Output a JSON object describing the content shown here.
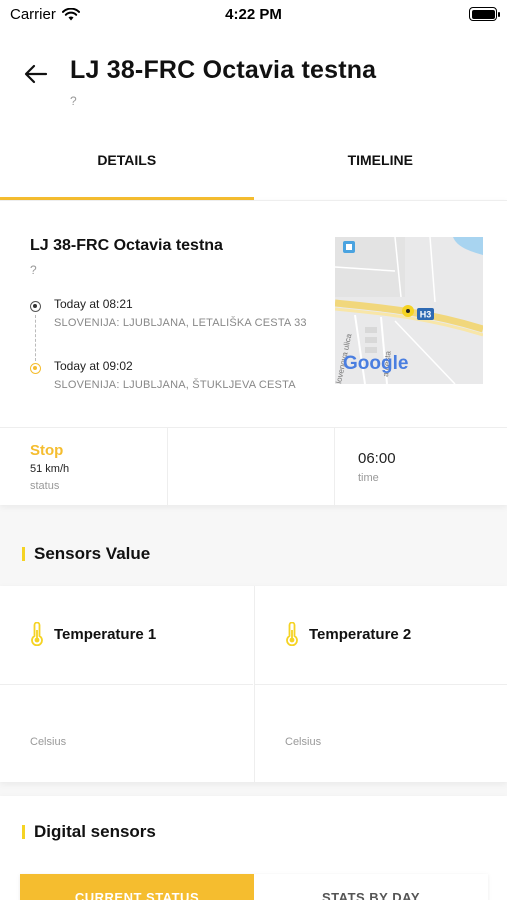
{
  "status_bar": {
    "carrier": "Carrier",
    "time": "4:22 PM"
  },
  "header": {
    "title": "LJ 38-FRC Octavia testna",
    "subtitle": "?"
  },
  "tabs": [
    {
      "label": "DETAILS",
      "active": true
    },
    {
      "label": "TIMELINE",
      "active": false
    }
  ],
  "vehicle": {
    "name": "LJ 38-FRC Octavia testna",
    "subtitle": "?",
    "start": {
      "time": "Today at 08:21",
      "address": "SLOVENIJA: LJUBLJANA, LETALIŠKA CESTA 33"
    },
    "end": {
      "time": "Today at 09:02",
      "address": "SLOVENIJA: LJUBLJANA, ŠTUKLJEVA CESTA"
    }
  },
  "map": {
    "road_label": "H3",
    "street_1": "lovenova ulica",
    "street_2": "a cesta",
    "logo": "Google"
  },
  "stats": {
    "status": "Stop",
    "speed": "51 km/h",
    "status_label": "status",
    "time": "06:00",
    "time_label": "time"
  },
  "sensors": {
    "title": "Sensors Value",
    "items": [
      {
        "name": "Temperature 1",
        "unit": "Celsius"
      },
      {
        "name": "Temperature 2",
        "unit": "Celsius"
      }
    ]
  },
  "digital": {
    "title": "Digital sensors",
    "tabs": [
      "CURRENT STATUS",
      "STATS BY DAY"
    ]
  },
  "colors": {
    "accent": "#f5bd2f",
    "section_marker": "#f5d323"
  }
}
